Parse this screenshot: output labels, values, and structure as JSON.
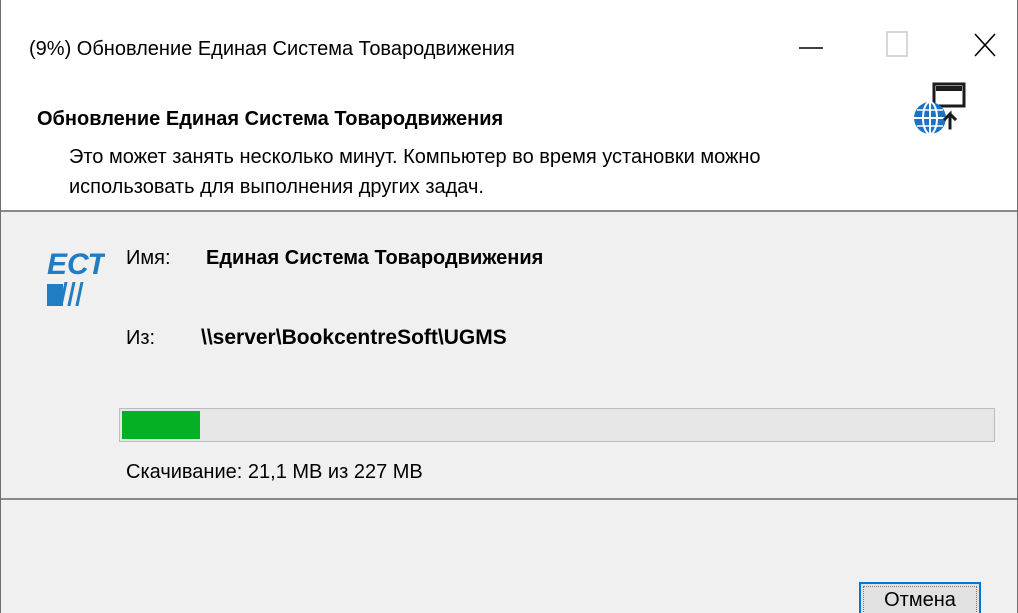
{
  "window": {
    "title": "(9%) Обновление Единая Система Товародвижения"
  },
  "header": {
    "title": "Обновление Единая Система Товародвижения",
    "description": "Это может занять несколько минут. Компьютер во время установки можно использовать для выполнения других задач.",
    "icon": "globe-update-icon"
  },
  "main": {
    "logo_text": "ЕСТ",
    "name_label": "Имя:",
    "name_value": "Единая Система Товародвижения",
    "from_label": "Из:",
    "from_value": "\\\\server\\BookcentreSoft\\UGMS",
    "progress_fraction": 0.09,
    "status": "Скачивание: 21,1 MB из 227 MB"
  },
  "footer": {
    "cancel_label": "Отмена"
  },
  "colors": {
    "progress_fill": "#06b025",
    "accent": "#0078d7",
    "logo_blue": "#1f7dc3"
  }
}
